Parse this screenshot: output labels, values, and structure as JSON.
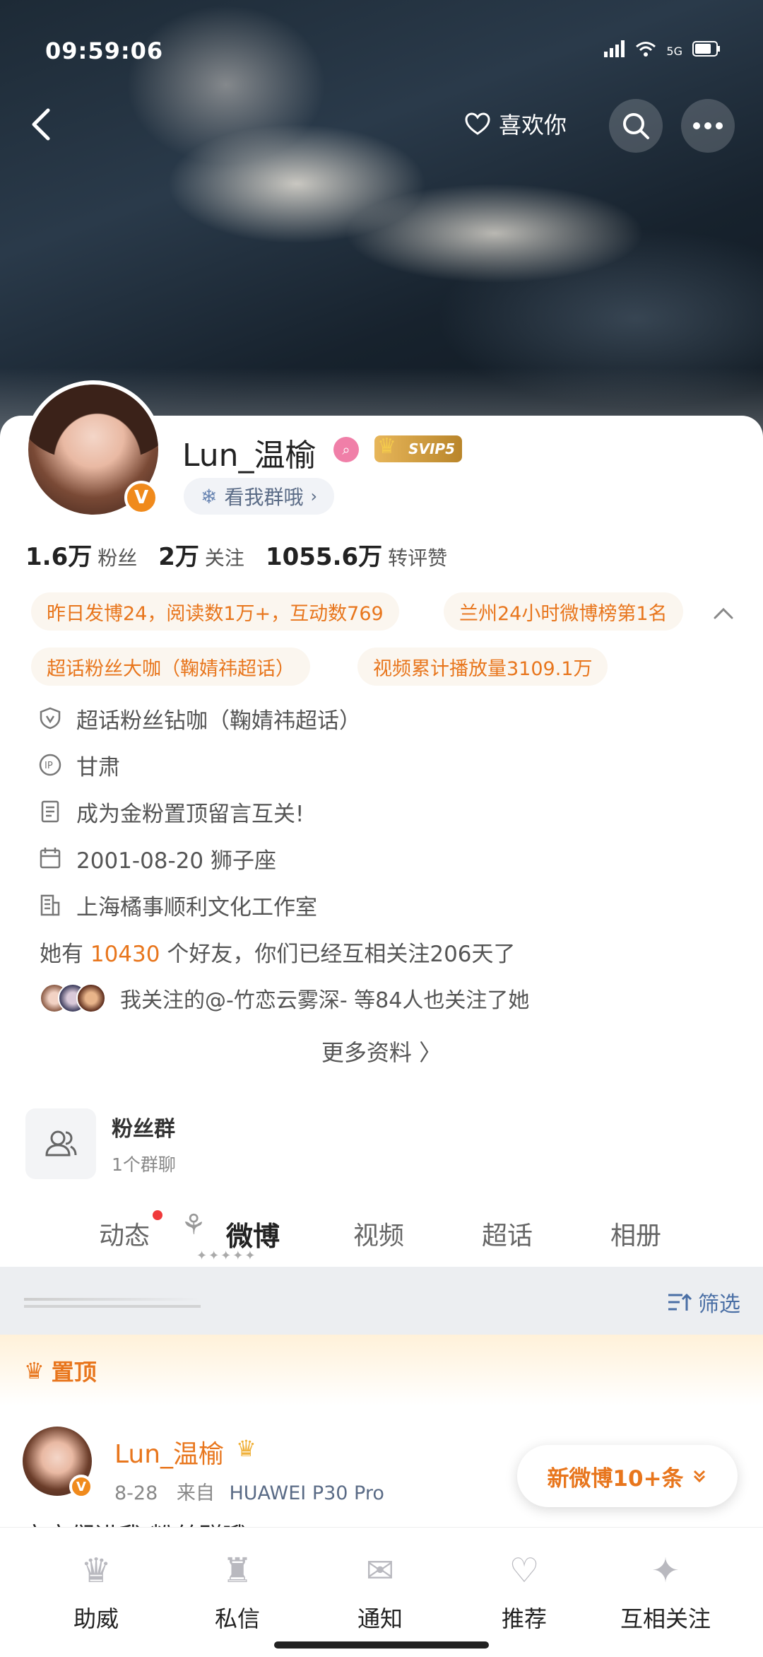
{
  "status": {
    "time": "09:59:06",
    "network": "5G"
  },
  "header": {
    "like_label": "喜欢你"
  },
  "profile": {
    "name": "Lun_温榆",
    "vip_label": "SVIP5",
    "verified_mark": "V",
    "group_pill": "看我群哦",
    "stats": [
      {
        "num": "1.6万",
        "label": "粉丝"
      },
      {
        "num": "2万",
        "label": "关注"
      },
      {
        "num": "1055.6万",
        "label": "转评赞"
      }
    ],
    "chips": [
      "昨日发博24，阅读数1万+，互动数769",
      "兰州24小时微博榜第1名",
      "超话粉丝大咖（鞠婧祎超话）",
      "视频累计播放量3109.1万"
    ],
    "info": [
      {
        "icon": "shield-v-icon",
        "text": "超话粉丝钻咖（鞠婧祎超话）"
      },
      {
        "icon": "ip-icon",
        "text": "甘肃"
      },
      {
        "icon": "document-icon",
        "text": "成为金粉置顶留言互关!"
      },
      {
        "icon": "calendar-icon",
        "text": "2001-08-20 狮子座"
      },
      {
        "icon": "building-icon",
        "text": "上海橘事顺利文化工作室"
      }
    ],
    "friends_prefix": "她有",
    "friends_count": "10430",
    "friends_suffix": "个好友，你们已经互相关注206天了",
    "mutual_text": "我关注的@-竹恋云雾深- 等84人也关注了她",
    "more_info": "更多资料 〉"
  },
  "fan_group": {
    "title": "粉丝群",
    "subtitle": "1个群聊"
  },
  "tabs": [
    "动态",
    "微博",
    "视频",
    "超话",
    "相册"
  ],
  "active_tab": "微博",
  "filter_label": "筛选",
  "pinned_label": "置顶",
  "post": {
    "author": "Lun_温榆",
    "date": "8-28",
    "source_prefix": "来自",
    "source": "HUAWEI P30 Pro",
    "text": "宝宝们进我 粉丝群哦!"
  },
  "new_posts_label": "新微博10+条",
  "bottom_nav": [
    "助威",
    "私信",
    "通知",
    "推荐",
    "互相关注"
  ],
  "colors": {
    "accent": "#e8761d",
    "link": "#4a6fa5",
    "badge_red": "#f0393b"
  }
}
